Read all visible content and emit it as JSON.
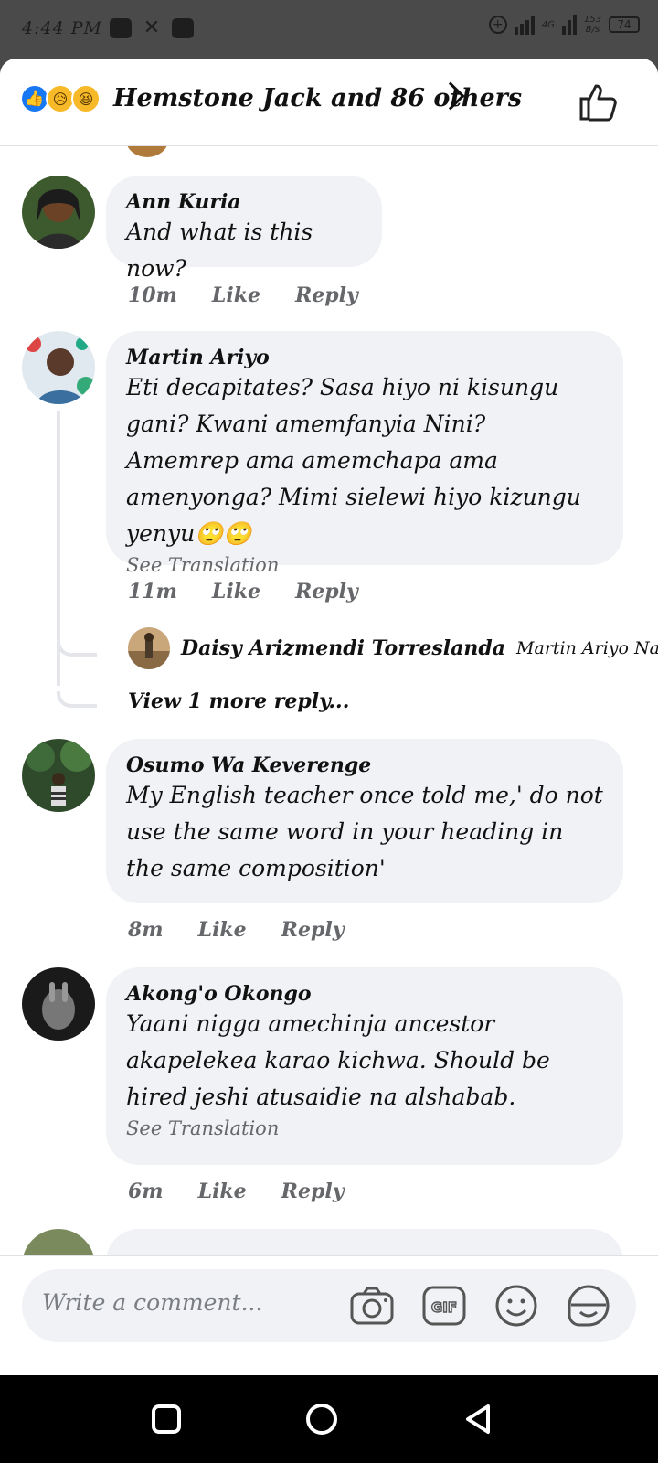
{
  "status_bar": {
    "time": "4:44 PM",
    "network": "4G",
    "data_rate_top": "153",
    "data_rate_bottom": "B/s",
    "battery": "74"
  },
  "reactions": {
    "icons": [
      "like-icon",
      "sad-icon",
      "haha-icon"
    ],
    "summary": "Hemstone Jack and 86 others"
  },
  "comments": [
    {
      "author": "Ann Kuria",
      "text": "And what is this now?",
      "time": "10m",
      "like": "Like",
      "reply": "Reply"
    },
    {
      "author": "Martin Ariyo",
      "text": "Eti decapitates? Sasa hiyo ni kisungu gani? Kwani amemfanyia Nini? Amemrep ama amemchapa ama amenyonga? Mimi sielewi hiyo kizungu yenyu🙄🙄",
      "see_translation": "See Translation",
      "time": "11m",
      "like": "Like",
      "reply": "Reply",
      "reply_preview": {
        "author": "Daisy Arizmendi Torreslanda",
        "snippet": "Martin Ariyo Na..."
      },
      "view_more": "View 1 more reply..."
    },
    {
      "author": "Osumo Wa Keverenge",
      "text": "My English teacher once told me,' do not use the same word in your heading in the same composition'",
      "time": "8m",
      "like": "Like",
      "reply": "Reply"
    },
    {
      "author": "Akong'o Okongo",
      "text": "Yaani nigga amechinja ancestor akapelekea karao kichwa. Should be hired jeshi atusaidie na alshabab.",
      "see_translation": "See Translation",
      "time": "6m",
      "like": "Like",
      "reply": "Reply"
    }
  ],
  "composer": {
    "placeholder": "Write a comment...",
    "icons": [
      "camera-icon",
      "gif-icon",
      "emoji-icon",
      "sticker-icon"
    ]
  },
  "colors": {
    "bubble": "#f0f2f5",
    "meta_text": "#65676b",
    "like_blue": "#1877f2",
    "status_bar": "#4a4a4a"
  }
}
